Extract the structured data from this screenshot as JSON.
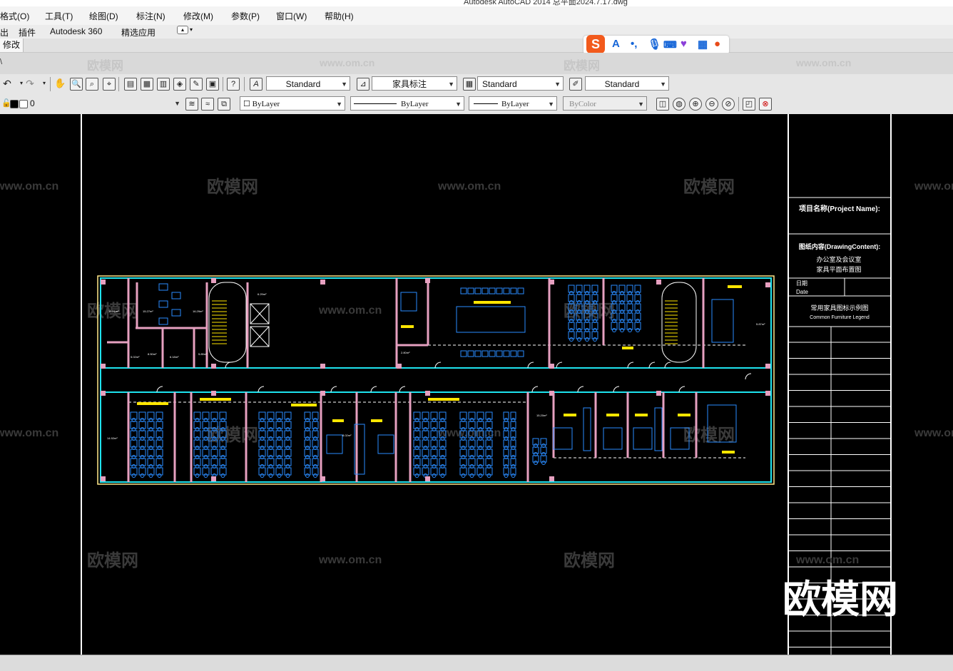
{
  "window": {
    "title": "Autodesk AutoCAD 2014    总平面2024.7.17.dwg"
  },
  "menu": [
    "格式(O)",
    "工具(T)",
    "绘图(D)",
    "标注(N)",
    "修改(M)",
    "参数(P)",
    "窗口(W)",
    "帮助(H)"
  ],
  "ribbon_tabs": [
    "出",
    "插件",
    "Autodesk 360",
    "精选应用"
  ],
  "panel_tab": "修改",
  "watermarks": {
    "logo": "欧模网",
    "url": "www.om.cn"
  },
  "toolbar_styles": {
    "text_style": "Standard",
    "dim_style": "家具标注",
    "table_style": "Standard",
    "mleader_style": "Standard"
  },
  "toolbar_props": {
    "layer": "0",
    "color": "ByLayer",
    "linetype": "ByLayer",
    "lineweight": "ByLayer",
    "plotstyle": "ByColor"
  },
  "title_block": {
    "project_name": "项目名称(Project Name):",
    "drawing_content": "图纸内容(DrawingContent):",
    "content_line1": "办公室及会议室",
    "content_line2": "家具平面布置图",
    "date_cn": "日期",
    "date_en": "Date",
    "legend_cn": "常用家具图标示例图",
    "legend_en": "Common Furniture Legend"
  },
  "room_areas": [
    "11.21m²",
    "15.27m²",
    "16.29m²",
    "5.02m²",
    "8.50m²",
    "6.18m²",
    "5.85m²",
    "6.29m²",
    "2.80m²",
    "5.87m²",
    "14.92m²",
    "15.20m²",
    "8.02m²"
  ],
  "colors": {
    "canvas": "#000000",
    "wall": "#1ee3ee",
    "wall_pink": "#e6a0c0",
    "furniture": "#2a8cff",
    "highlight": "#ffe600",
    "outline": "#ffe98a"
  }
}
